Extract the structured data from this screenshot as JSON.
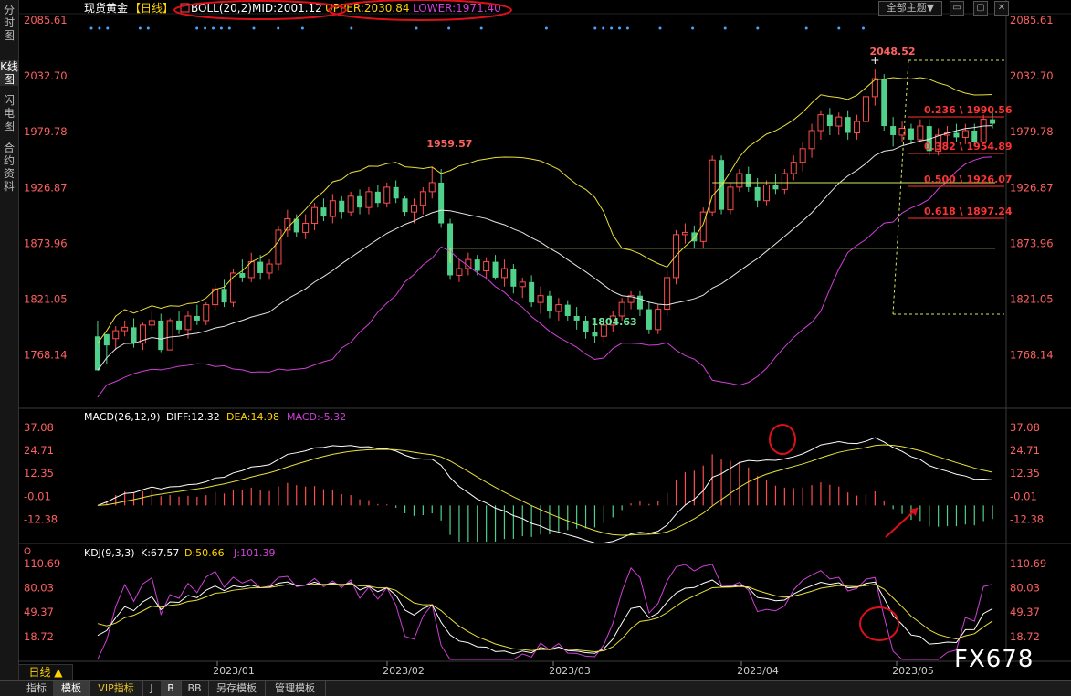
{
  "sidebar": [
    {
      "label": "分时图"
    },
    {
      "label": "K线图"
    },
    {
      "label": "闪电图"
    },
    {
      "label": "合约资料"
    }
  ],
  "header": {
    "instrument": "现货黄金",
    "period_tag": "【日线】",
    "boll": "BOLL(20,2)",
    "mid": "MID:2001.12",
    "upper": "UPPER:2030.84",
    "lower": "LOWER:1971.40",
    "theme_button": "全部主题▼"
  },
  "window_buttons": [
    "▭",
    "▢",
    "✕"
  ],
  "colors": {
    "up": "#ff4d4d",
    "down": "#4fd18b",
    "mid": "#e6e6e6",
    "upper": "#e8e03a",
    "lower": "#d040d8",
    "fib_label": "#ff3333",
    "level_line": "#d4e75a",
    "annotation": "#e0101a",
    "axis_text": "#ff6060"
  },
  "price_axis": {
    "ticks": [
      "2085.61",
      "2032.70",
      "1979.78",
      "1926.87",
      "1873.96",
      "1821.05",
      "1768.14"
    ]
  },
  "x_axis": {
    "labels": [
      "2023/01",
      "2023/02",
      "2023/03",
      "2023/04",
      "2023/05"
    ]
  },
  "annotations": {
    "high_2048": "2048.52",
    "high_1959": "1959.57",
    "low_1804": "1804.63"
  },
  "fib_levels": [
    {
      "label": "0.236 \\ 1990.56",
      "value": 1990.56
    },
    {
      "label": "0.382 \\ 1954.89",
      "value": 1954.89
    },
    {
      "label": "0.500 \\ 1926.07",
      "value": 1926.07
    },
    {
      "label": "0.618 \\ 1897.24",
      "value": 1897.24
    }
  ],
  "macd": {
    "title": "MACD(26,12,9)",
    "diff": "DIFF:12.32",
    "dea": "DEA:14.98",
    "macd": "MACD:-5.32",
    "ticks": [
      "37.08",
      "24.71",
      "12.35",
      "-0.01",
      "-12.38"
    ]
  },
  "kdj": {
    "title": "KDJ(9,3,3)",
    "k": "K:67.57",
    "d": "D:50.66",
    "j": "J:101.39",
    "ticks": [
      "110.69",
      "80.03",
      "49.37",
      "18.72"
    ]
  },
  "period_button": "日线 ▲",
  "bottom_tabs": [
    {
      "label": "指标"
    },
    {
      "label": "模板"
    },
    {
      "label": "VIP指标"
    },
    {
      "label": "J"
    },
    {
      "label": "B"
    },
    {
      "label": "BB"
    },
    {
      "label": "另存模板"
    },
    {
      "label": "管理模板"
    }
  ],
  "watermark": "FX678",
  "chart_data": {
    "type": "candlestick",
    "title": "现货黄金",
    "ylim": [
      1750,
      2095
    ],
    "candles": [
      [
        1812,
        1826,
        1785,
        1782
      ],
      [
        1814,
        1808,
        1788,
        1804
      ],
      [
        1810,
        1821,
        1800,
        1817
      ],
      [
        1817,
        1826,
        1812,
        1820
      ],
      [
        1820,
        1828,
        1802,
        1806
      ],
      [
        1806,
        1824,
        1800,
        1822
      ],
      [
        1822,
        1834,
        1818,
        1826
      ],
      [
        1826,
        1832,
        1798,
        1800
      ],
      [
        1800,
        1828,
        1800,
        1826
      ],
      [
        1826,
        1834,
        1814,
        1818
      ],
      [
        1818,
        1834,
        1810,
        1830
      ],
      [
        1830,
        1840,
        1822,
        1826
      ],
      [
        1826,
        1842,
        1822,
        1840
      ],
      [
        1840,
        1858,
        1834,
        1854
      ],
      [
        1854,
        1862,
        1838,
        1842
      ],
      [
        1842,
        1872,
        1838,
        1868
      ],
      [
        1868,
        1880,
        1860,
        1864
      ],
      [
        1864,
        1886,
        1860,
        1878
      ],
      [
        1878,
        1884,
        1862,
        1868
      ],
      [
        1868,
        1880,
        1862,
        1876
      ],
      [
        1876,
        1910,
        1870,
        1906
      ],
      [
        1906,
        1924,
        1900,
        1916
      ],
      [
        1916,
        1920,
        1900,
        1904
      ],
      [
        1904,
        1920,
        1898,
        1912
      ],
      [
        1912,
        1930,
        1906,
        1926
      ],
      [
        1926,
        1934,
        1914,
        1918
      ],
      [
        1918,
        1938,
        1912,
        1932
      ],
      [
        1932,
        1936,
        1916,
        1922
      ],
      [
        1922,
        1940,
        1918,
        1936
      ],
      [
        1936,
        1942,
        1920,
        1926
      ],
      [
        1926,
        1944,
        1920,
        1940
      ],
      [
        1940,
        1946,
        1926,
        1930
      ],
      [
        1930,
        1948,
        1926,
        1944
      ],
      [
        1944,
        1950,
        1930,
        1934
      ],
      [
        1934,
        1936,
        1918,
        1922
      ],
      [
        1922,
        1934,
        1912,
        1928
      ],
      [
        1928,
        1944,
        1920,
        1940
      ],
      [
        1940,
        1962,
        1934,
        1948
      ],
      [
        1948,
        1960,
        1908,
        1912
      ],
      [
        1912,
        1916,
        1862,
        1866
      ],
      [
        1866,
        1880,
        1860,
        1872
      ],
      [
        1872,
        1886,
        1866,
        1880
      ],
      [
        1880,
        1884,
        1866,
        1870
      ],
      [
        1870,
        1882,
        1862,
        1878
      ],
      [
        1878,
        1884,
        1862,
        1864
      ],
      [
        1864,
        1880,
        1856,
        1872
      ],
      [
        1872,
        1876,
        1850,
        1856
      ],
      [
        1856,
        1864,
        1846,
        1860
      ],
      [
        1860,
        1866,
        1838,
        1842
      ],
      [
        1842,
        1856,
        1832,
        1848
      ],
      [
        1848,
        1852,
        1828,
        1834
      ],
      [
        1834,
        1846,
        1826,
        1840
      ],
      [
        1840,
        1844,
        1826,
        1830
      ],
      [
        1830,
        1838,
        1818,
        1826
      ],
      [
        1826,
        1830,
        1810,
        1816
      ],
      [
        1816,
        1822,
        1806,
        1812
      ],
      [
        1812,
        1826,
        1806,
        1822
      ],
      [
        1822,
        1834,
        1816,
        1830
      ],
      [
        1830,
        1846,
        1826,
        1842
      ],
      [
        1842,
        1852,
        1836,
        1848
      ],
      [
        1848,
        1852,
        1830,
        1836
      ],
      [
        1836,
        1842,
        1814,
        1818
      ],
      [
        1818,
        1840,
        1814,
        1836
      ],
      [
        1836,
        1870,
        1830,
        1864
      ],
      [
        1864,
        1906,
        1858,
        1902
      ],
      [
        1902,
        1912,
        1894,
        1904
      ],
      [
        1904,
        1910,
        1890,
        1896
      ],
      [
        1896,
        1926,
        1890,
        1922
      ],
      [
        1922,
        1972,
        1918,
        1968
      ],
      [
        1968,
        1972,
        1920,
        1924
      ],
      [
        1924,
        1948,
        1920,
        1944
      ],
      [
        1944,
        1960,
        1940,
        1956
      ],
      [
        1956,
        1962,
        1940,
        1944
      ],
      [
        1944,
        1952,
        1926,
        1932
      ],
      [
        1932,
        1950,
        1928,
        1946
      ],
      [
        1946,
        1956,
        1938,
        1942
      ],
      [
        1942,
        1960,
        1938,
        1956
      ],
      [
        1956,
        1972,
        1950,
        1966
      ],
      [
        1966,
        1984,
        1958,
        1978
      ],
      [
        1978,
        2000,
        1970,
        1994
      ],
      [
        1994,
        2012,
        1986,
        2008
      ],
      [
        2008,
        2014,
        1990,
        1998
      ],
      [
        1998,
        2010,
        1990,
        2006
      ],
      [
        2006,
        2012,
        1986,
        1992
      ],
      [
        1992,
        2008,
        1986,
        2002
      ],
      [
        2002,
        2028,
        1998,
        2024
      ],
      [
        2024,
        2048,
        2016,
        2040
      ],
      [
        2040,
        2044,
        1994,
        1998
      ],
      [
        1998,
        2006,
        1980,
        1990
      ],
      [
        1990,
        2002,
        1984,
        1996
      ],
      [
        1996,
        2000,
        1982,
        1986
      ],
      [
        1986,
        2004,
        1984,
        1998
      ],
      [
        1998,
        2004,
        1972,
        1976
      ],
      [
        1976,
        1996,
        1972,
        1990
      ],
      [
        1990,
        1998,
        1980,
        1992
      ],
      [
        1992,
        2000,
        1984,
        1988
      ],
      [
        1988,
        2000,
        1982,
        1994
      ],
      [
        1994,
        2000,
        1980,
        1984
      ],
      [
        1984,
        2008,
        1982,
        2004
      ],
      [
        2004,
        2012,
        1996,
        2000
      ]
    ],
    "levels": [
      1948,
      1890
    ],
    "macd_range": [
      -17,
      40
    ],
    "kdj_range": [
      5,
      118
    ]
  }
}
